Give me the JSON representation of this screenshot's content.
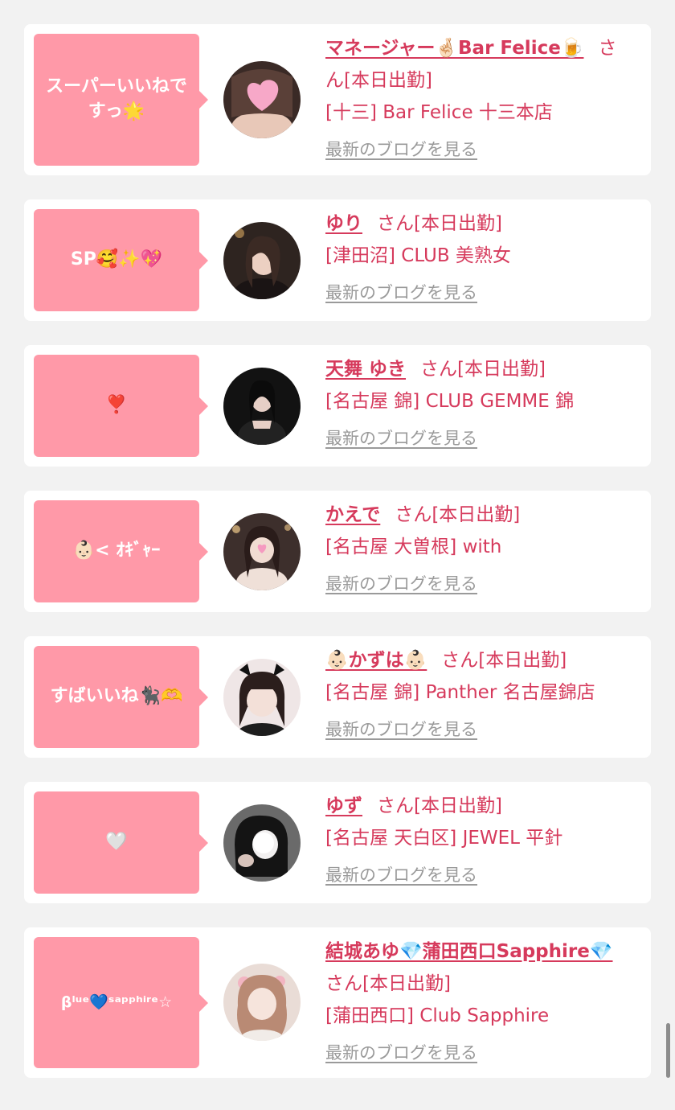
{
  "links": {
    "blog": "最新のブログを見る"
  },
  "cards": [
    {
      "bubble": "スーパーいいねですっ🌟",
      "name": "マネージャー🤞🏻Bar Felice🍺",
      "status": "さん[本日出勤]",
      "shop": "[十三] Bar Felice 十三本店"
    },
    {
      "bubble": "SP🥰✨💖",
      "name": "ゆり",
      "status": "さん[本日出勤]",
      "shop": "[津田沼] CLUB 美熟女"
    },
    {
      "bubble": "❣️",
      "name": "天舞 ゆき",
      "status": "さん[本日出勤]",
      "shop": "[名古屋 錦] CLUB GEMME 錦"
    },
    {
      "bubble": "👶🏻< ｵｷﾞｬｰ",
      "name": "かえで",
      "status": "さん[本日出勤]",
      "shop": "[名古屋 大曽根] with"
    },
    {
      "bubble": "すばいいね🐈‍⬛🫶",
      "name": "👶🏻かずは👶🏻",
      "status": "さん[本日出勤]",
      "shop": "[名古屋 錦] Panther 名古屋錦店"
    },
    {
      "bubble": "🤍",
      "name": "ゆず",
      "status": "さん[本日出勤]",
      "shop": "[名古屋 天白区] JEWEL 平針"
    },
    {
      "bubble": "βˡᵘᵉ💙ˢᵃᵖᵖʰⁱʳᵉ☆",
      "name": "結城あゆ💎蒲田西口Sapphire💎",
      "status": "さん[本日出勤]",
      "shop": "[蒲田西口] Club Sapphire"
    }
  ]
}
